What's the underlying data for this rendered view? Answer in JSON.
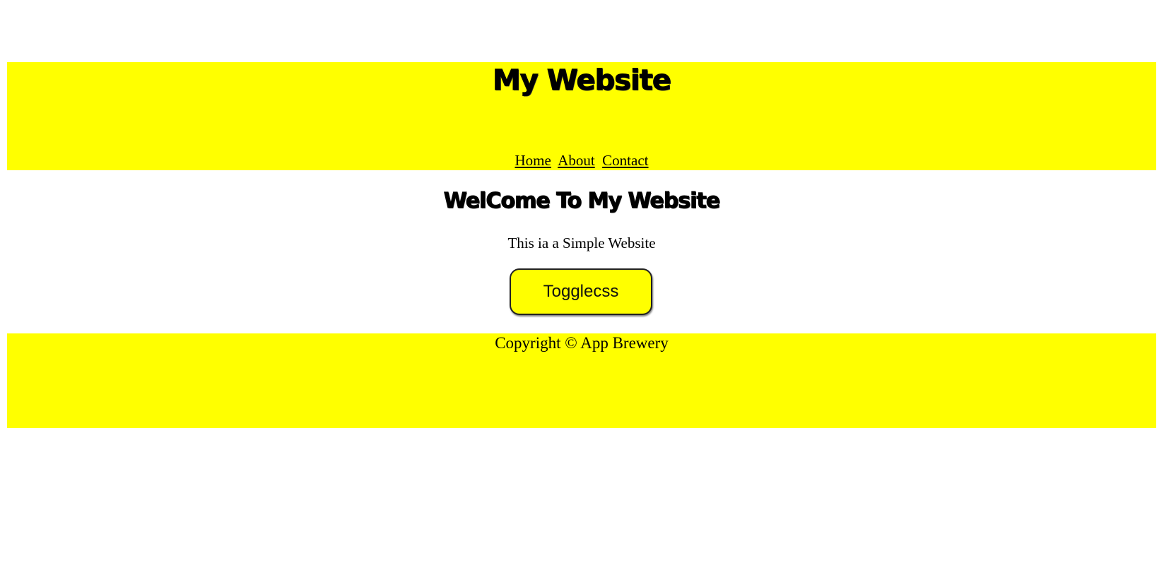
{
  "header": {
    "title": "My Website",
    "nav": [
      {
        "label": "Home"
      },
      {
        "label": "About"
      },
      {
        "label": "Contact"
      }
    ]
  },
  "main": {
    "heading": "WelCome To My Website",
    "intro": "This ia a Simple Website",
    "toggle_button_label": "Togglecss"
  },
  "footer": {
    "copyright": "Copyright © App Brewery"
  },
  "colors": {
    "accent": "#ffff00",
    "text": "#000000",
    "background": "#ffffff"
  }
}
